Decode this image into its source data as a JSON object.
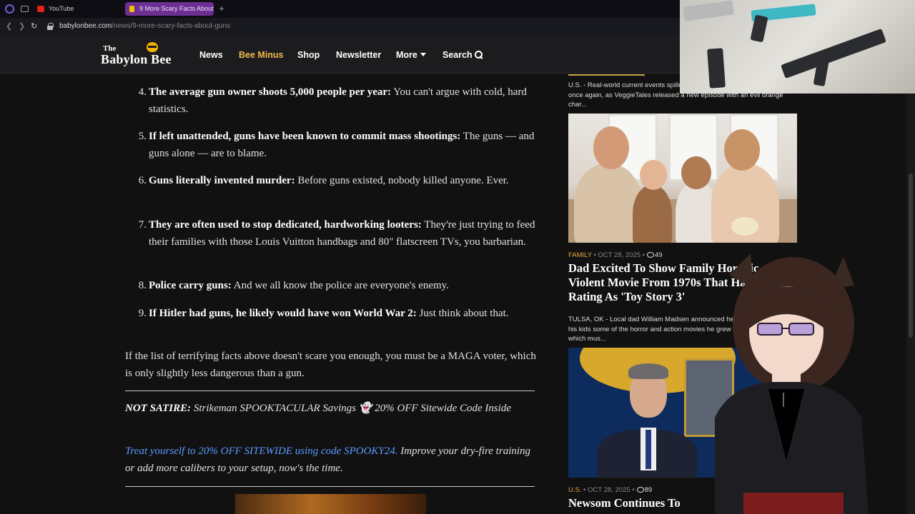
{
  "browser": {
    "tabs": [
      {
        "label": "YouTube",
        "active": false
      },
      {
        "label": "9 More Scary Facts About",
        "active": true
      }
    ],
    "url_host": "babylonbee.com",
    "url_path": "/news/9-more-scary-facts-about-guns"
  },
  "header": {
    "logo_the": "The",
    "logo_name": "Babylon Bee",
    "nav": {
      "news": "News",
      "bee_minus": "Bee Minus",
      "shop": "Shop",
      "newsletter": "Newsletter",
      "more": "More",
      "search": "Search"
    },
    "accent_color": "#f0b94a"
  },
  "article": {
    "facts": [
      {
        "num": "4.",
        "bold": "The average gun owner shoots 5,000 people per year:",
        "text": "You can't argue with cold, hard statistics."
      },
      {
        "num": "5.",
        "bold": "If left unattended, guns have been known to commit mass shootings:",
        "text": "The guns — and guns alone — are to blame."
      },
      {
        "num": "6.",
        "bold": "Guns literally invented murder:",
        "text": "Before guns existed, nobody killed anyone. Ever."
      },
      {
        "num": "7.",
        "bold": "They are often used to stop dedicated, hardworking looters:",
        "text": "They're just trying to feed their families with those Louis Vuitton handbags and 80\" flatscreen TVs, you barbarian."
      },
      {
        "num": "8.",
        "bold": "Police carry guns:",
        "text": "And we all know the police are everyone's enemy."
      },
      {
        "num": "9.",
        "bold": "If Hitler had guns, he likely would have won World War 2:",
        "text": "Just think about that."
      }
    ],
    "closing": "If the list of terrifying facts above doesn't scare you enough, you must be a MAGA voter, which is only slightly less dangerous than a gun.",
    "promo_label": "NOT SATIRE:",
    "promo_title": "Strikeman SPOOKTACULAR Savings 👻 20% OFF Sitewide Code Inside",
    "promo_link": "Treat yourself to 20% OFF SITEWIDE using code SPOOKY24.",
    "promo_body": "Improve your dry-fire training or add more calibers to your setup, now's the time."
  },
  "sidebar": {
    "excerpt_top": "U.S. - Real-world current events spilled over into children's entertainment once again, as VeggieTales released a new episode with an evil orange char...",
    "story1": {
      "category": "FAMILY",
      "date": "OCT 28, 2025",
      "comments": "49",
      "headline": "Dad Excited To Show Family Horrific Violent Movie From 1970s That Had Same Rating As 'Toy Story 3'",
      "excerpt": "TULSA, OK - Local dad William Madsen announced he was excited to show his kids some of the horror and action movies he grew up with in the 1970s, which mus..."
    },
    "story2": {
      "category": "U.S.",
      "date": "OCT 28, 2025",
      "comments": "89",
      "headline": "Newsom Continues To"
    }
  }
}
